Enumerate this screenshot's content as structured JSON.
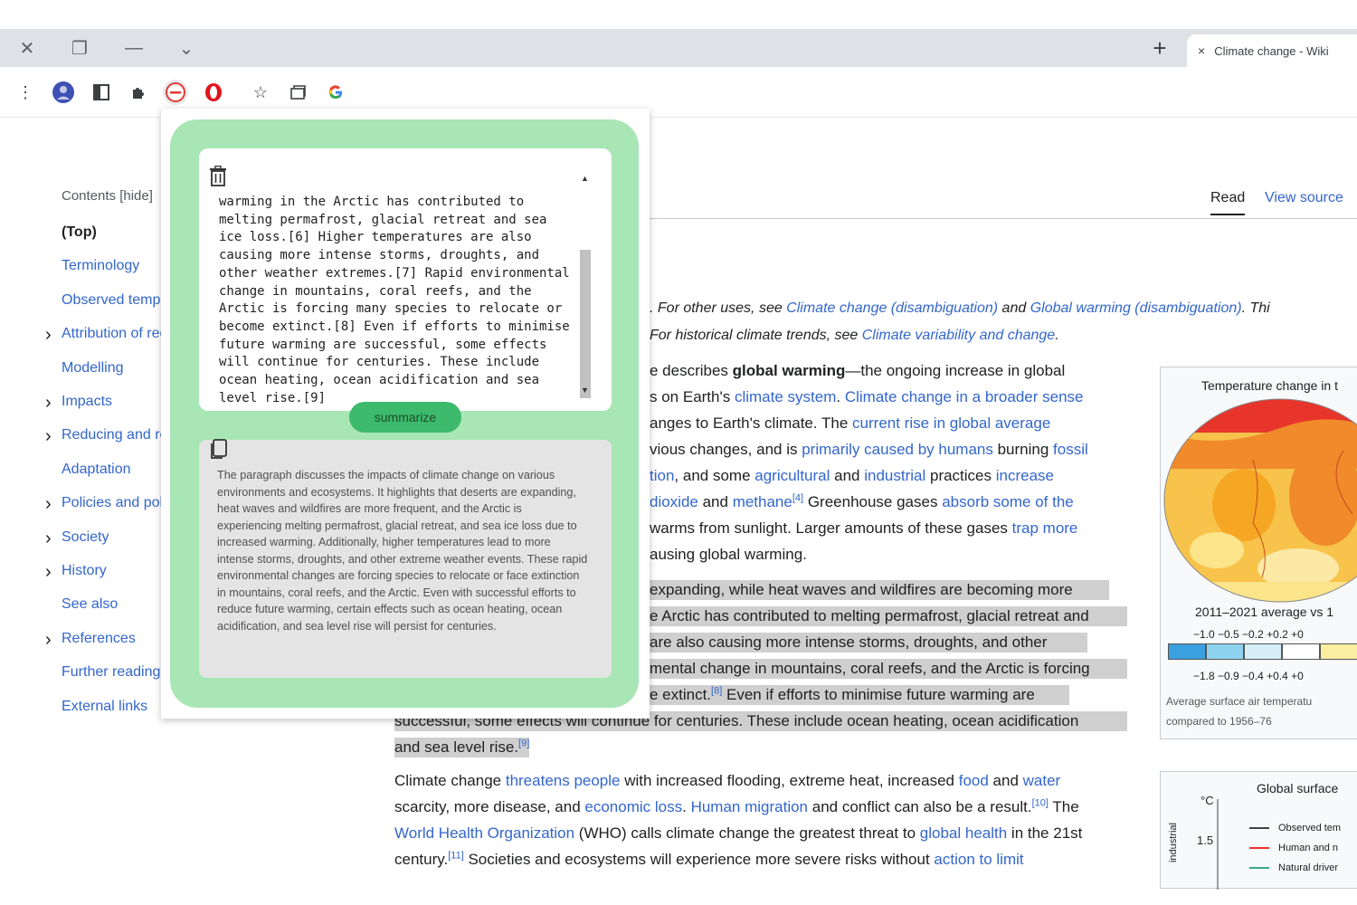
{
  "browser": {
    "tab_title": "Climate change - Wiki",
    "tab_close": "×",
    "new_tab": "+"
  },
  "toc": {
    "header": "Contents [hide]",
    "items": [
      {
        "label": "(Top)",
        "chevron": false,
        "top": true
      },
      {
        "label": "Terminology",
        "chevron": false
      },
      {
        "label": "Observed temperature rise",
        "chevron": false
      },
      {
        "label": "Attribution of recent temperature rise",
        "chevron": true
      },
      {
        "label": "Modelling",
        "chevron": false
      },
      {
        "label": "Impacts",
        "chevron": true
      },
      {
        "label": "Reducing and recapturing emissions",
        "chevron": true
      },
      {
        "label": "Adaptation",
        "chevron": false
      },
      {
        "label": "Policies and politics",
        "chevron": true
      },
      {
        "label": "Society",
        "chevron": true
      },
      {
        "label": "History",
        "chevron": true
      },
      {
        "label": "See also",
        "chevron": false
      },
      {
        "label": "References",
        "chevron": true
      },
      {
        "label": "Further reading",
        "chevron": false
      },
      {
        "label": "External links",
        "chevron": false
      }
    ]
  },
  "article_tabs": {
    "read": "Read",
    "view_source": "View source"
  },
  "hatnote": {
    "line1_prefix": ". For other uses, see ",
    "link1": "Climate change (disambiguation)",
    "and": " and ",
    "link2": "Global warming (disambiguation)",
    "line1_suffix": ". Thi",
    "line2_prefix": "For historical climate trends, see ",
    "link3": "Climate variability and change",
    "line2_suffix": "."
  },
  "popup": {
    "input_text": "warming in the Arctic has contributed to melting permafrost, glacial retreat and sea ice loss.[6] Higher temperatures are also causing more intense storms, droughts, and other weather extremes.[7] Rapid environmental change in mountains, coral reefs, and the Arctic is forcing many species to relocate or become extinct.[8] Even if efforts to minimise future warming are successful, some effects will continue for centuries. These include ocean heating, ocean acidification and sea level rise.[9]",
    "summarize_label": "summarize",
    "output_text": "The paragraph discusses the impacts of climate change on various environments and ecosystems. It highlights that deserts are expanding, heat waves and wildfires are more frequent, and the Arctic is experiencing melting permafrost, glacial retreat, and sea ice loss due to increased warming. Additionally, higher temperatures lead to more intense storms, droughts, and other extreme weather events. These rapid environmental changes are forcing species to relocate or face extinction in mountains, coral reefs, and the Arctic. Even with successful efforts to reduce future warming, certain effects such as ocean heating, ocean acidification, and sea level rise will persist for centuries."
  },
  "infobox1": {
    "title": "Temperature change in t",
    "subtitle": "2011–2021 average vs 1",
    "ticks_top": "−1.0  −0.5  −0.2  +0.2  +0",
    "ticks_bottom": "−1.8  −0.9  −0.4  +0.4  +0",
    "caption1": "Average surface air temperatu",
    "caption2": "compared to 1956–76",
    "colors": [
      "#3aa0e0",
      "#8dd3f0",
      "#d6eef8",
      "#ffffff",
      "#fbeea0",
      "#f5d800"
    ]
  },
  "infobox2": {
    "title": "Global surface",
    "unit": "°C",
    "axis_label": "industrial",
    "tick": "1.5",
    "legend": [
      "Observed tem",
      "Human and n",
      "Natural driver"
    ],
    "legend_colors": [
      "#444444",
      "#e8352c",
      "#3aaa8a"
    ]
  },
  "para1": {
    "l1_a": "e describes ",
    "l1_b": "global warming",
    "l1_c": "—the ongoing increase in global",
    "l2_a": "s on Earth's ",
    "l2_link1": "climate system",
    "l2_b": ". ",
    "l2_link2": "Climate change in a broader sense",
    "l3_a": "anges to Earth's climate. The ",
    "l3_link": "current rise in global average",
    "l4_a": "vious changes, and is ",
    "l4_link1": "primarily caused by humans",
    "l4_b": " burning ",
    "l4_link2": "fossil",
    "l5_link1": "tion",
    "l5_a": ", and some ",
    "l5_link2": "agricultural",
    "l5_b": " and ",
    "l5_link3": "industrial",
    "l5_c": " practices ",
    "l5_link4": "increase",
    "l6_link1": "dioxide",
    "l6_a": " and ",
    "l6_link2": "methane",
    "l6_sup": "[4]",
    "l6_b": " Greenhouse gases ",
    "l6_link3": "absorb some of the",
    "l7_a": "warms from sunlight. Larger amounts of these gases ",
    "l7_link": "trap more",
    "l8_a": "ausing global warming."
  },
  "para2": {
    "l1": "expanding, while heat waves and wildfires are becoming more",
    "l2": "e Arctic has contributed to melting permafrost, glacial retreat and",
    "l3": " are also causing more intense storms, droughts, and other",
    "l4": "mental change in mountains, coral reefs, and the Arctic is forcing",
    "l5_a": "e extinct.",
    "l5_sup": "[8]",
    "l5_b": " Even if efforts to minimise future warming are",
    "l6": "successful, some effects will continue for centuries. These include ocean heating, ocean acidification",
    "l7_a": "and sea level rise.",
    "l7_sup": "[9]"
  },
  "para3": {
    "l1_a": "Climate change ",
    "l1_link1": "threatens people",
    "l1_b": " with increased flooding, extreme heat, increased ",
    "l1_link2": "food",
    "l1_c": " and ",
    "l1_link3": "water",
    "l2_a": "scarcity, more disease, and ",
    "l2_link1": "economic loss",
    "l2_b": ". ",
    "l2_link2": "Human migration",
    "l2_c": " and conflict can also be a result.",
    "l2_sup": "[10]",
    "l2_d": " The",
    "l3_link1": "World Health Organization",
    "l3_a": " (WHO) calls climate change the greatest threat to ",
    "l3_link2": "global health",
    "l3_b": " in the 21st",
    "l4_a": "century.",
    "l4_sup": "[11]",
    "l4_b": " Societies and ecosystems will experience more severe risks without ",
    "l4_link": "action to limit"
  }
}
